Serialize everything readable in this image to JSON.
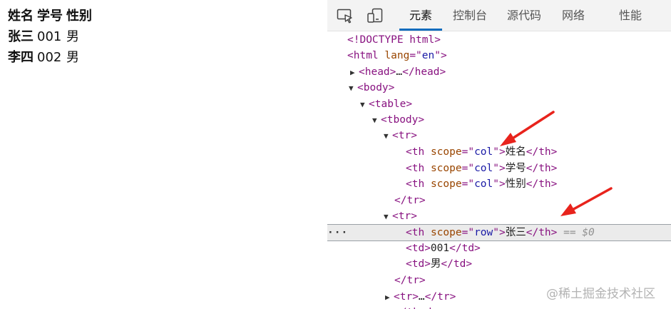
{
  "page": {
    "headers": [
      "姓名",
      "学号",
      "性别"
    ],
    "rows": [
      {
        "name": "张三",
        "id": "001",
        "gender": "男"
      },
      {
        "name": "李四",
        "id": "002",
        "gender": "男"
      }
    ]
  },
  "devtools": {
    "tabs": [
      "元素",
      "控制台",
      "源代码",
      "网络",
      "性能"
    ],
    "active_tab": "元素",
    "accent": "#0f6cbd"
  },
  "dom": {
    "doctype": "<!DOCTYPE html>",
    "html_lang": "en",
    "head_collapsed": "…",
    "header_cells": [
      "姓名",
      "学号",
      "性别"
    ],
    "scope_col": "col",
    "scope_row": "row",
    "row_header": "张三",
    "td1": "001",
    "td2": "男",
    "tr_collapsed": "…",
    "selected_marker": "== $0",
    "ellipsis": "···"
  },
  "watermark": "@稀土掘金技术社区"
}
